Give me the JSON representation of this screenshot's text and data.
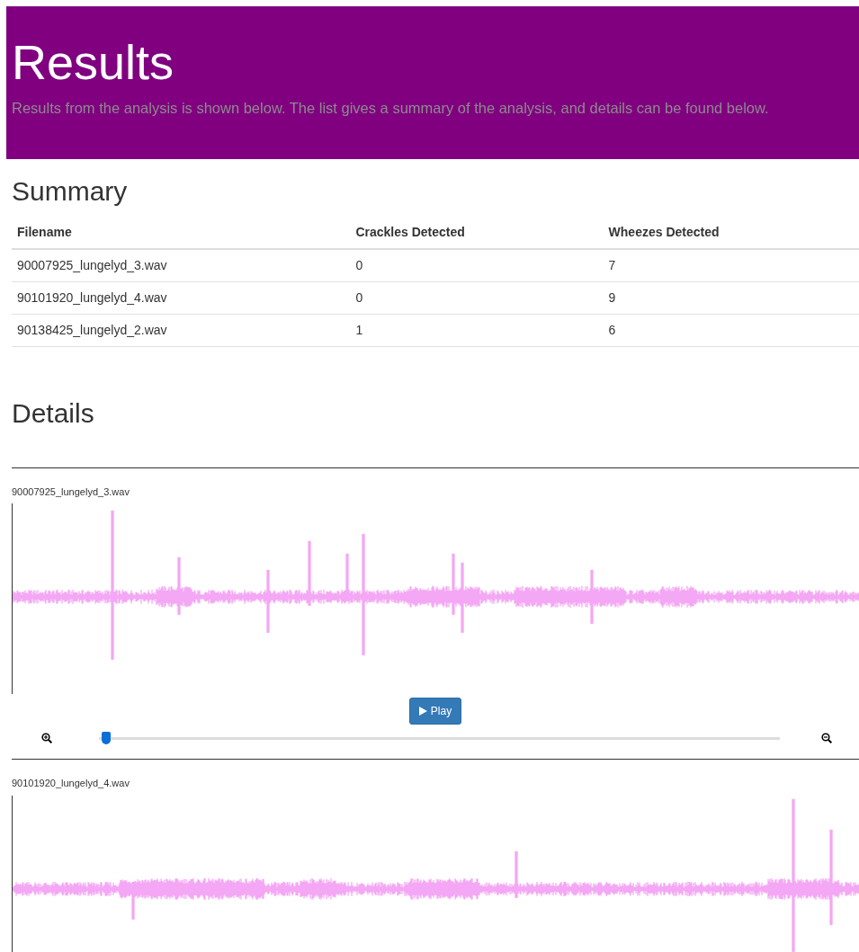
{
  "header": {
    "title": "Results",
    "lead": "Results from the analysis is shown below. The list gives a summary of the analysis, and details can be found below."
  },
  "summary": {
    "heading": "Summary",
    "columns": [
      "Filename",
      "Crackles Detected",
      "Wheezes Detected"
    ],
    "rows": [
      [
        "90007925_lungelyd_3.wav",
        "0",
        "7"
      ],
      [
        "90101920_lungelyd_4.wav",
        "0",
        "9"
      ],
      [
        "90138425_lungelyd_2.wav",
        "1",
        "6"
      ]
    ]
  },
  "details": {
    "heading": "Details",
    "recordings": [
      {
        "filename": "90007925_lungelyd_3.wav",
        "player": {
          "button": "Play",
          "zoom": {
            "level": 0.01
          }
        }
      },
      {
        "filename": "90101920_lungelyd_4.wav"
      }
    ]
  }
}
